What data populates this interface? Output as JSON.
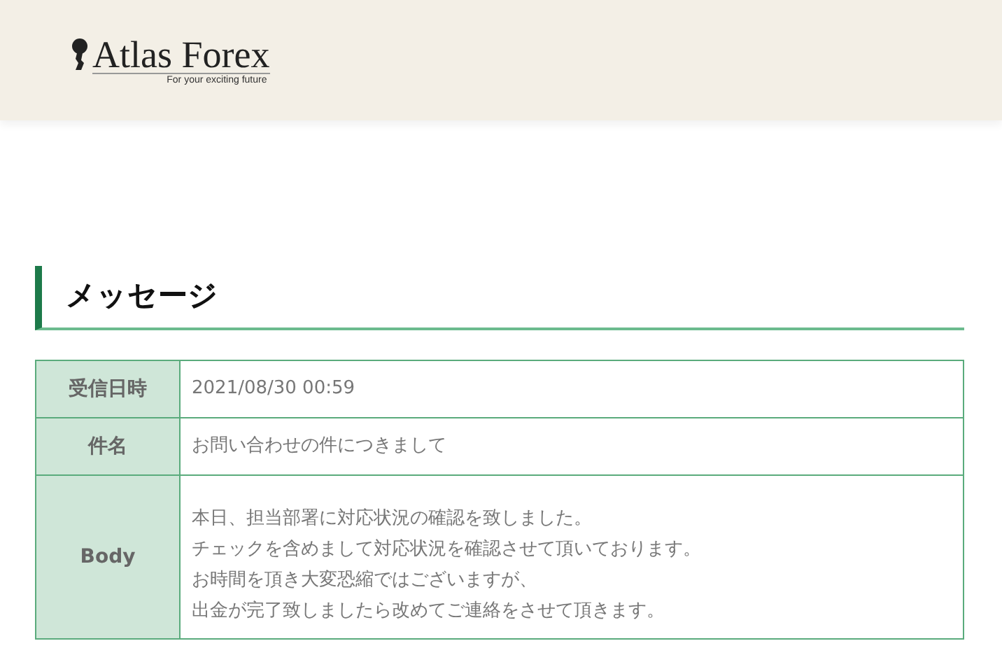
{
  "header": {
    "logo": {
      "name": "Atlas Forex",
      "tagline": "For your exciting future"
    }
  },
  "message": {
    "heading": "メッセージ",
    "rows": [
      {
        "label": "受信日時",
        "lines": [
          "2021/08/30 00:59"
        ]
      },
      {
        "label": "件名",
        "lines": [
          "お問い合わせの件につきまして"
        ]
      },
      {
        "label": "Body",
        "lines": [
          "本日、担当部署に対応状況の確認を致しました。",
          "チェックを含めまして対応状況を確認させて頂いております。",
          "お時間を頂き大変恐縮ではございますが、",
          "出金が完了致しましたら改めてご連絡をさせて頂きます。"
        ]
      }
    ]
  }
}
